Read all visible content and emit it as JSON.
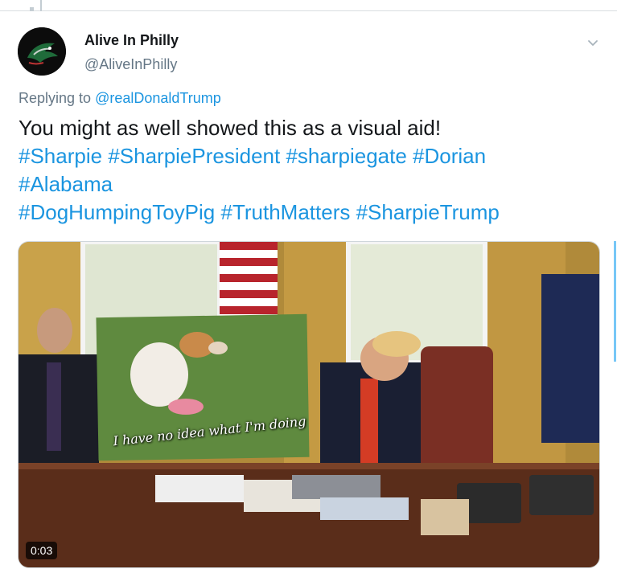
{
  "tweet": {
    "author": {
      "display_name": "Alive In Philly",
      "handle": "@AliveInPhilly",
      "avatar_icon": "eagles-logo-avatar"
    },
    "replying_prefix": "Replying to",
    "replying_to": "@realDonaldTrump",
    "text_line1": "You might as well showed this as a visual aid!",
    "hashtags_line2": [
      "#Sharpie",
      "#SharpiePresident",
      "#sharpiegate",
      "#Dorian"
    ],
    "hashtags_line3": [
      "#Alabama"
    ],
    "hashtags_line4": [
      "#DogHumpingToyPig",
      "#TruthMatters",
      "#SharpieTrump"
    ],
    "menu_icon": "chevron-down-icon"
  },
  "media": {
    "type": "video",
    "duration": "0:03",
    "overlay_caption": "I have no idea what I'm doing"
  },
  "colors": {
    "link": "#1b95e0",
    "text": "#14171a",
    "secondary": "#657786"
  }
}
